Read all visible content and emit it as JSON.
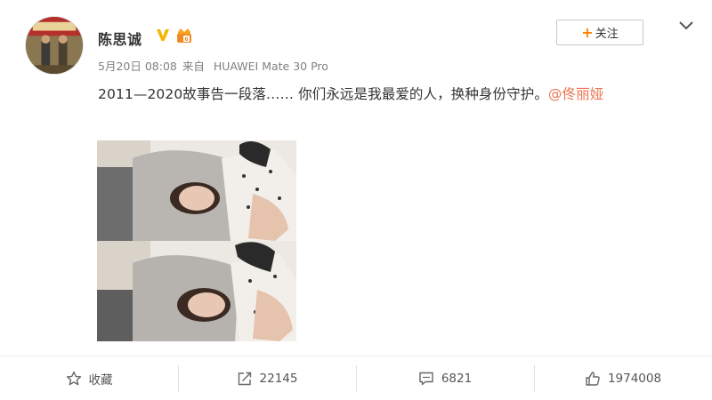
{
  "post": {
    "username": "陈思诚",
    "timestamp": "5月20日 08:08",
    "source_prefix": "来自",
    "device": "HUAWEI Mate 30 Pro",
    "text": "2011—2020故事告一段落…… 你们永远是我最爱的人，换种身份守护。",
    "mention": "@佟丽娅",
    "follow_label": "关注",
    "follow_plus": "+"
  },
  "actions": {
    "favorite_label": "收藏",
    "repost_count": "22145",
    "comment_count": "6821",
    "like_count": "1974008"
  },
  "icons": {
    "verified": "verified-v-icon",
    "level": "member-level-icon",
    "more": "chevron-down-icon",
    "favorite": "star-icon",
    "repost": "share-icon",
    "comment": "comment-icon",
    "like": "thumbs-up-icon"
  },
  "colors": {
    "accent": "#ff8200",
    "mention": "#eb7350",
    "verified": "#f4b400",
    "text": "#333333",
    "meta": "#808080"
  }
}
